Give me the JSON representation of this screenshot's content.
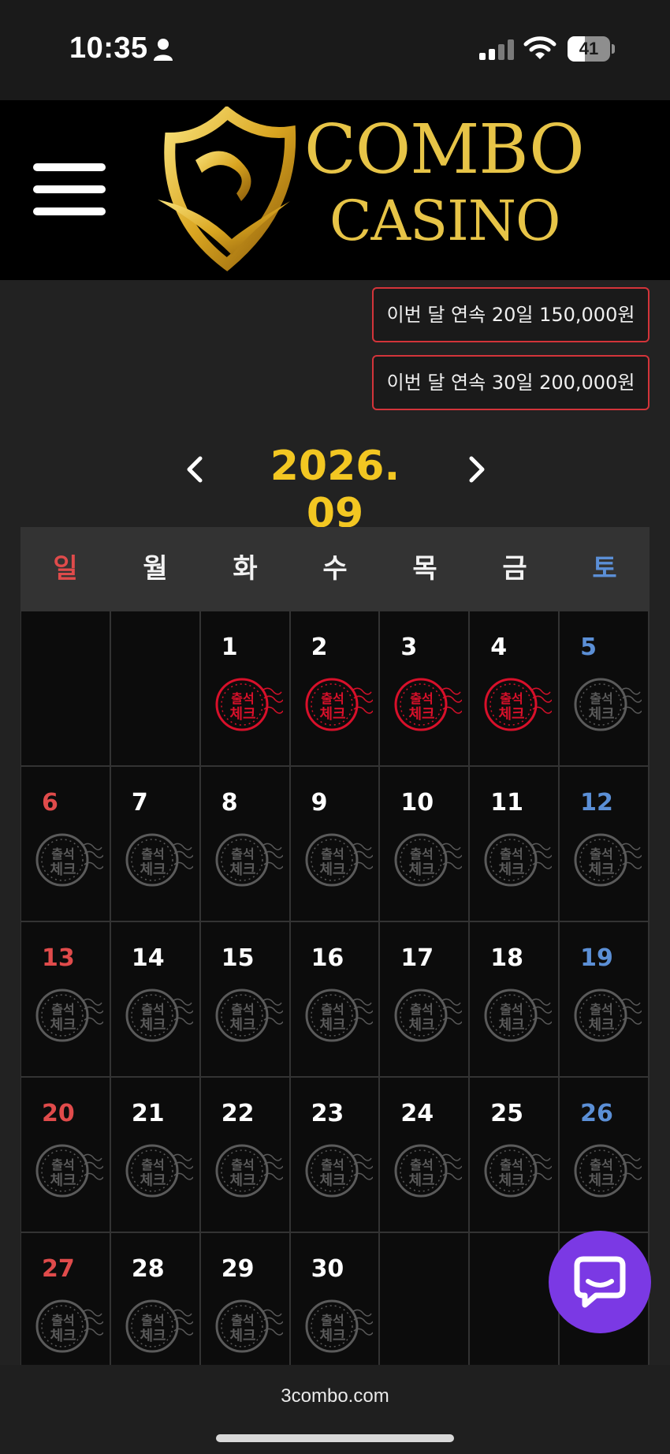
{
  "status_bar": {
    "time": "10:35",
    "battery": "41",
    "battery_level_percent": 41
  },
  "header": {
    "logo_line1": "COMBO",
    "logo_line2": "CASINO",
    "brand_color": "#e7c447"
  },
  "bonus_buttons": [
    {
      "label": "이번 달 연속 20일 150,000원"
    },
    {
      "label": "이번 달 연속 30일 200,000원"
    }
  ],
  "calendar": {
    "month_label": "2026. 09",
    "accent_color": "#f3c722",
    "weekdays": [
      "일",
      "월",
      "화",
      "수",
      "목",
      "금",
      "토"
    ],
    "stamp_text": [
      "출석",
      "체크"
    ],
    "first_weekday_index": 2,
    "days_in_month": 30,
    "checked_days": [
      1,
      2,
      3,
      4
    ],
    "checked_color": "#d8102a",
    "unchecked_color": "#5a5a5a"
  },
  "footer": {
    "url": "3combo.com"
  }
}
